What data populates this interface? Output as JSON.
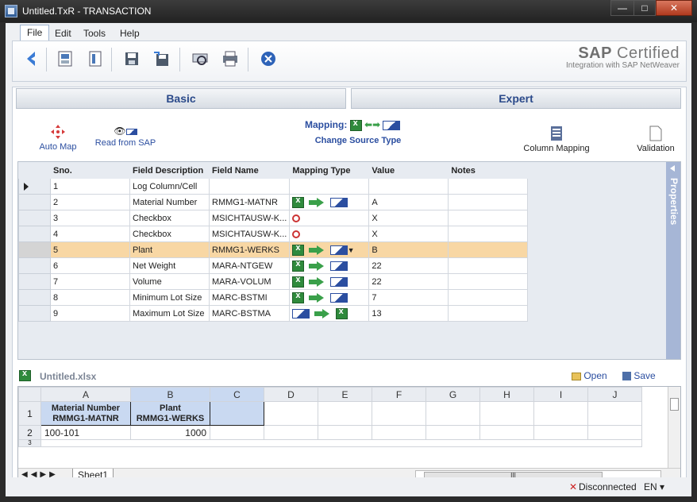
{
  "window": {
    "title": "Untitled.TxR - TRANSACTION",
    "min": "—",
    "max": "□",
    "close": "✕"
  },
  "menu": [
    "File",
    "Edit",
    "Tools",
    "Help"
  ],
  "toolbar": {
    "icons": [
      "back-icon",
      "view-icon",
      "layout-icon",
      "save-icon",
      "save-as-icon",
      "print-preview-icon",
      "print-icon",
      "cancel-icon"
    ]
  },
  "brand": {
    "line1": "SAP",
    "line1b": "Certified",
    "line2": "Integration with SAP NetWeaver"
  },
  "tabs": {
    "basic": "Basic",
    "expert": "Expert"
  },
  "actions": {
    "auto_map": "Auto Map",
    "read_sap": "Read from SAP",
    "mapping": "Mapping:",
    "change_source": "Change Source Type",
    "column_mapping": "Column Mapping",
    "validation": "Validation"
  },
  "grid": {
    "headers": [
      "Sno.",
      "Field Description",
      "Field Name",
      "Mapping Type",
      "Value",
      "Notes"
    ],
    "rows": [
      {
        "sno": "1",
        "desc": "Log Column/Cell",
        "field": "",
        "map": "none",
        "value": "",
        "notes": ""
      },
      {
        "sno": "2",
        "desc": "Material Number",
        "field": "RMMG1-MATNR",
        "map": "xl-sap",
        "value": "A",
        "notes": ""
      },
      {
        "sno": "3",
        "desc": "Checkbox",
        "field": "MSICHTAUSW-K...",
        "map": "link",
        "value": "X",
        "notes": ""
      },
      {
        "sno": "4",
        "desc": "Checkbox",
        "field": "MSICHTAUSW-K...",
        "map": "link",
        "value": "X",
        "notes": ""
      },
      {
        "sno": "5",
        "desc": "Plant",
        "field": "RMMG1-WERKS",
        "map": "xl-sap-dd",
        "value": "B",
        "notes": ""
      },
      {
        "sno": "6",
        "desc": "Net Weight",
        "field": "MARA-NTGEW",
        "map": "xl-sap",
        "value": "22",
        "notes": ""
      },
      {
        "sno": "7",
        "desc": "Volume",
        "field": "MARA-VOLUM",
        "map": "xl-sap",
        "value": "22",
        "notes": ""
      },
      {
        "sno": "8",
        "desc": "Minimum Lot Size",
        "field": "MARC-BSTMI",
        "map": "xl-sap",
        "value": "7",
        "notes": ""
      },
      {
        "sno": "9",
        "desc": "Maximum Lot Size",
        "field": "MARC-BSTMA",
        "map": "sap-xl",
        "value": "13",
        "notes": ""
      }
    ],
    "properties": "Properties"
  },
  "sheet": {
    "file": "Untitled.xlsx",
    "open": "Open",
    "save": "Save",
    "cols": [
      "A",
      "B",
      "C",
      "D",
      "E",
      "F",
      "G",
      "H",
      "I",
      "J"
    ],
    "r1": {
      "a1": "Material Number",
      "a2": "RMMG1-MATNR",
      "b1": "Plant",
      "b2": "RMMG1-WERKS"
    },
    "r2": {
      "a": "100-101",
      "b": "1000"
    },
    "rows": [
      "1",
      "2",
      "3"
    ],
    "tab": "Sheet1",
    "scroll_label": "III"
  },
  "status": {
    "conn": "Disconnected",
    "lang": "EN"
  },
  "colors": {
    "accent": "#2b4ea0",
    "selected_row": "#f8d7a4",
    "excel_green": "#2f8a3c",
    "properties": "#a6b6d6"
  }
}
